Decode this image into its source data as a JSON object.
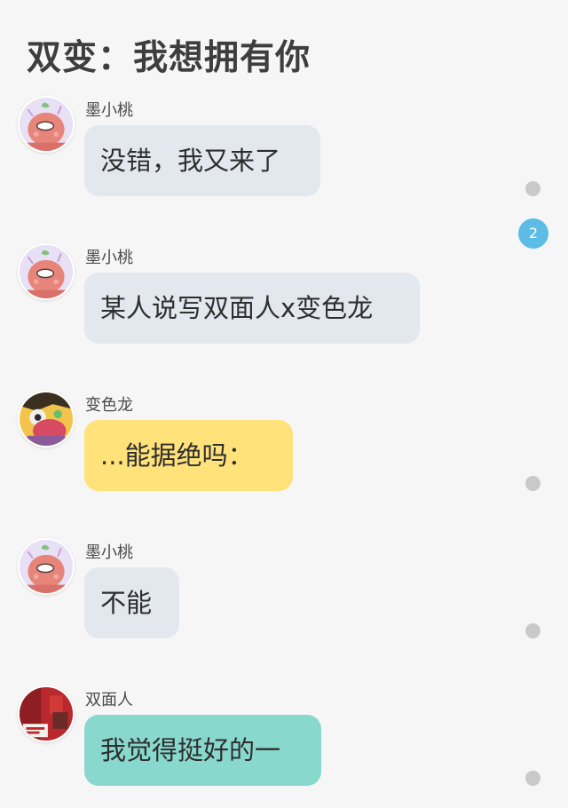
{
  "header": {
    "title": "双变：我想拥有你"
  },
  "colors": {
    "background": "#f6f6f6",
    "bubble_default": "#e3e8ef",
    "bubble_yellow": "#ffe27a",
    "bubble_teal": "#89d8cd",
    "read_dot": "#c9c9c9",
    "badge": "#5bbde6"
  },
  "messages": [
    {
      "sender": "墨小桃",
      "text": "没错，我又来了",
      "avatar": "peach-avatar",
      "bubble_color": "#e3e8ef",
      "marker": "dot"
    },
    {
      "sender": "墨小桃",
      "text": "某人说写双面人x变色龙",
      "avatar": "peach-avatar",
      "bubble_color": "#e3e8ef",
      "marker": "badge",
      "badge_count": "2"
    },
    {
      "sender": "变色龙",
      "text": "...能据绝吗：",
      "avatar": "chameleon-avatar",
      "bubble_color": "#ffe27a",
      "marker": "dot"
    },
    {
      "sender": "墨小桃",
      "text": "不能",
      "avatar": "peach-avatar",
      "bubble_color": "#e3e8ef",
      "marker": "dot"
    },
    {
      "sender": "双面人",
      "text": "我觉得挺好的一",
      "avatar": "twoface-avatar",
      "bubble_color": "#89d8cd",
      "marker": "dot"
    }
  ]
}
